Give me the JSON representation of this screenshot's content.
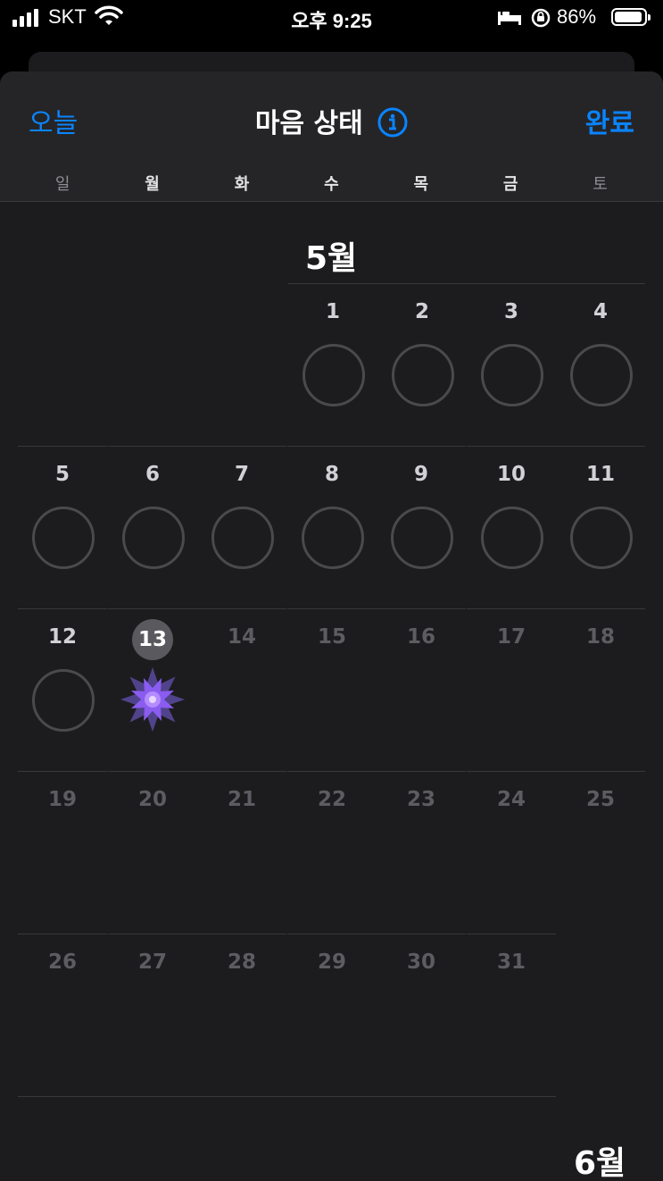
{
  "status_bar": {
    "carrier": "SKT",
    "time": "오후 9:25",
    "battery": "86%"
  },
  "nav": {
    "today": "오늘",
    "title": "마음 상태",
    "done": "완료"
  },
  "weekdays": [
    "일",
    "월",
    "화",
    "수",
    "목",
    "금",
    "토"
  ],
  "may": {
    "label": "5월",
    "week1": [
      "1",
      "2",
      "3",
      "4"
    ],
    "week2": [
      "5",
      "6",
      "7",
      "8",
      "9",
      "10",
      "11"
    ],
    "week3": [
      "12",
      "13",
      "14",
      "15",
      "16",
      "17",
      "18"
    ],
    "week4": [
      "19",
      "20",
      "21",
      "22",
      "23",
      "24",
      "25"
    ],
    "week5": [
      "26",
      "27",
      "28",
      "29",
      "30",
      "31"
    ]
  },
  "june": {
    "label": "6월"
  },
  "colors": {
    "accent": "#0a84ff",
    "mood_flower": "#8a5cf0"
  }
}
